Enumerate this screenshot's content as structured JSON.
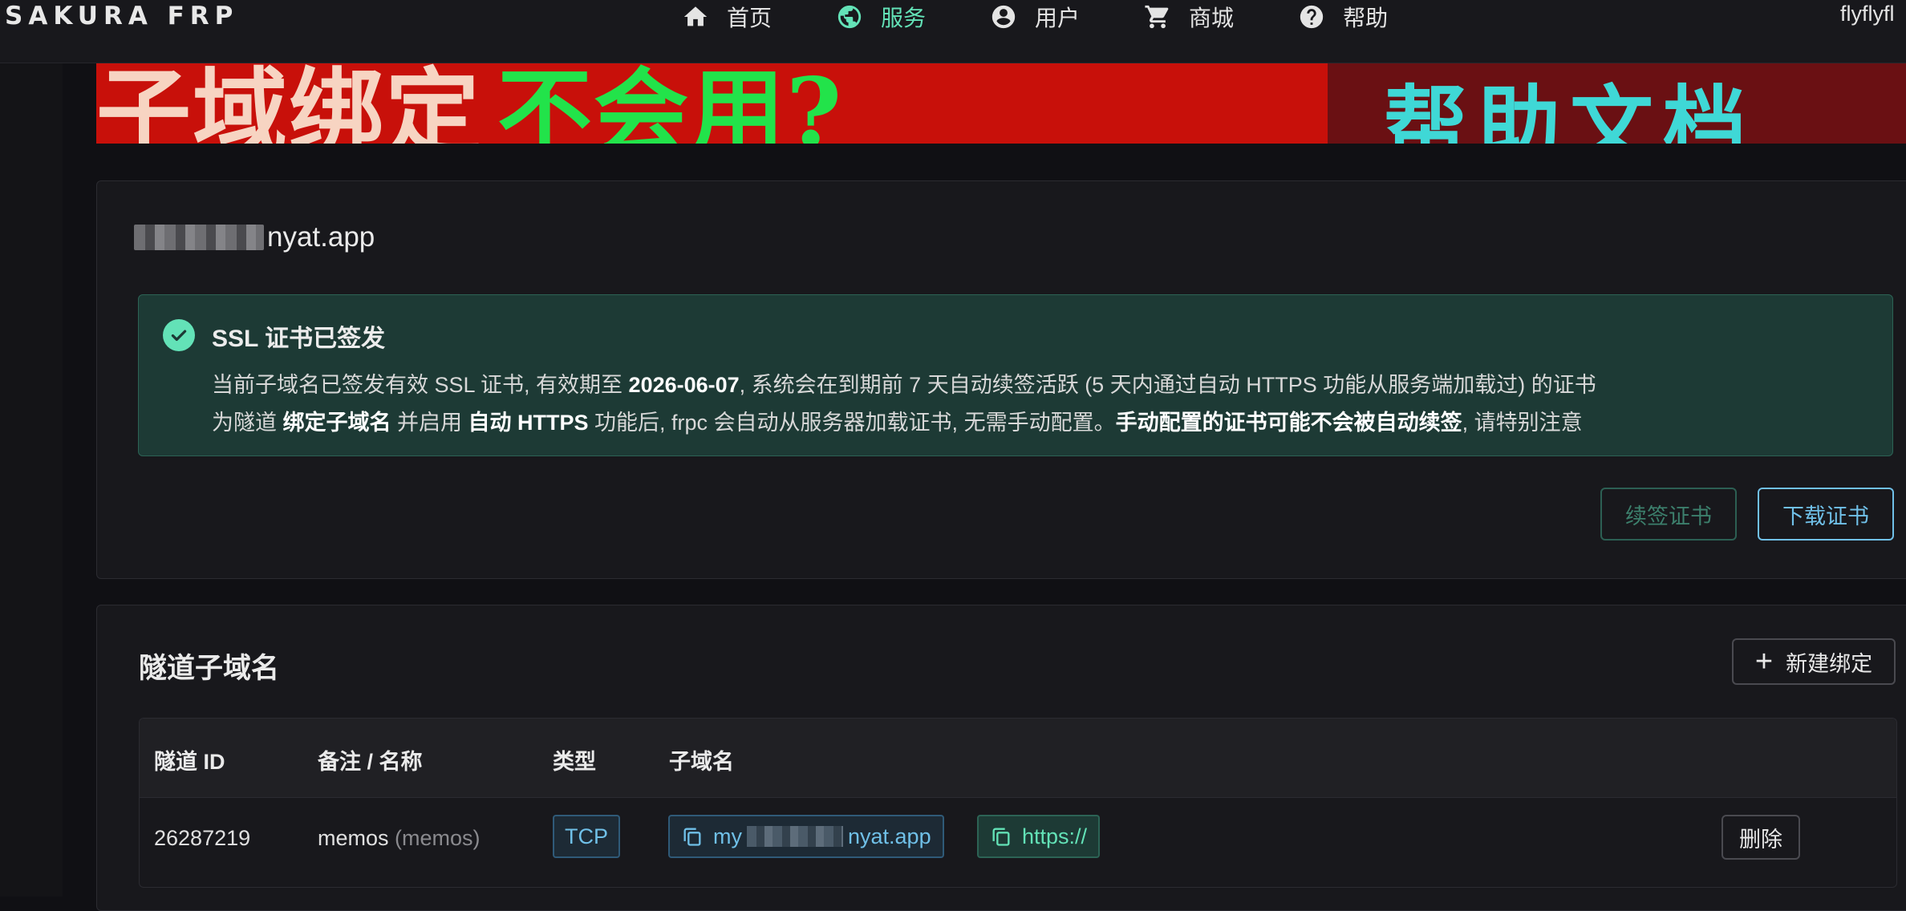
{
  "header": {
    "brand": "SAKURA FRP",
    "nav": [
      {
        "label": "首页",
        "icon": "home-icon",
        "active": false
      },
      {
        "label": "服务",
        "icon": "globe-icon",
        "active": true
      },
      {
        "label": "用户",
        "icon": "user-icon",
        "active": false
      },
      {
        "label": "商城",
        "icon": "cart-icon",
        "active": false
      },
      {
        "label": "帮助",
        "icon": "help-icon",
        "active": false
      }
    ],
    "username": "flyflyfl"
  },
  "banner": {
    "left_text_white": "子域绑定",
    "left_text_green": "不会用?",
    "right_text": "帮助文档"
  },
  "domain": {
    "suffix": "nyat.app"
  },
  "ssl_alert": {
    "title": "SSL 证书已签发",
    "line1_pre": "当前子域名已签发有效 SSL 证书, 有效期至 ",
    "line1_date": "2026-06-07",
    "line1_post": ", 系统会在到期前 7 天自动续签活跃 (5 天内通过自动 HTTPS 功能从服务端加载过) 的证书",
    "line2_a": "为隧道 ",
    "line2_b": "绑定子域名",
    "line2_c": " 并启用 ",
    "line2_d": "自动 HTTPS",
    "line2_e": " 功能后, frpc 会自动从服务器加载证书, 无需手动配置。",
    "line2_f": "手动配置的证书可能不会被自动续签",
    "line2_g": ", 请特别注意"
  },
  "actions": {
    "renew": "续签证书",
    "download": "下载证书"
  },
  "tunnels": {
    "title": "隧道子域名",
    "new_button": "新建绑定",
    "columns": [
      "隧道 ID",
      "备注 / 名称",
      "类型",
      "子域名"
    ],
    "rows": [
      {
        "id": "26287219",
        "name": "memos",
        "name_note": "(memos)",
        "type": "TCP",
        "subdomain_prefix": "my",
        "subdomain_suffix": "nyat.app",
        "https": "https://",
        "delete": "删除"
      }
    ]
  },
  "colors": {
    "accent_green": "#63e2b7",
    "accent_blue": "#70c0e8",
    "banner_red": "#c8100a"
  }
}
